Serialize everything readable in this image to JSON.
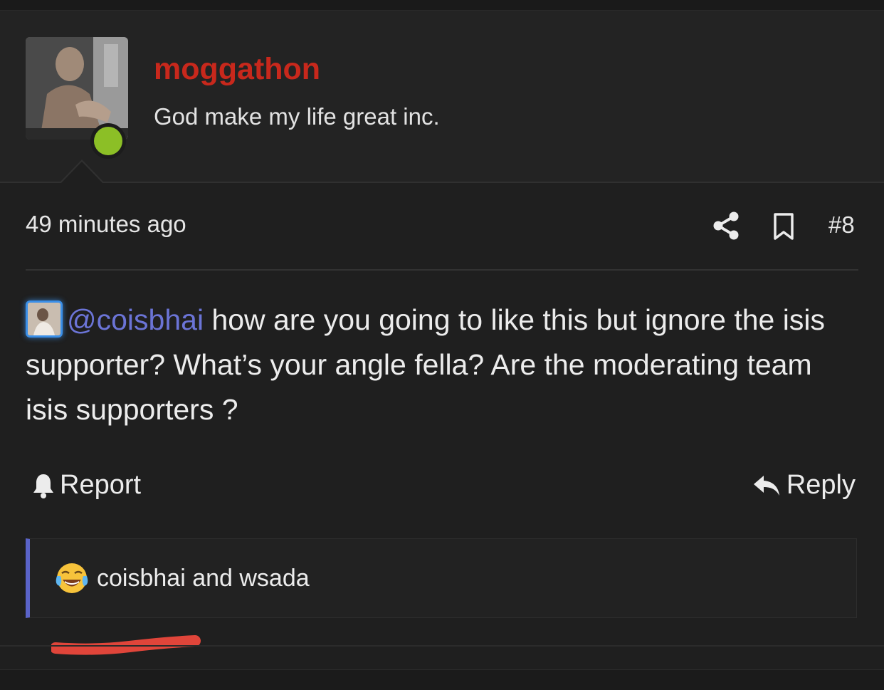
{
  "user": {
    "username": "moggathon",
    "title": "God make my life great inc.",
    "online": true
  },
  "post": {
    "time": "49 minutes ago",
    "number": "#8",
    "mention": "@coisbhai",
    "body_text": " how are you going to like this but ignore the isis supporter? What’s your angle fella? Are the moderating team isis supporters ?"
  },
  "actions": {
    "report_label": "Report",
    "reply_label": "Reply"
  },
  "reactions": {
    "emoji": "face-with-tears-of-joy",
    "text": "coisbhai and wsada"
  },
  "colors": {
    "username": "#c8281c",
    "mention": "#6b74d6",
    "online": "#8cbf26",
    "reaction_border": "#5a63c8",
    "annotation": "#e0453a"
  }
}
